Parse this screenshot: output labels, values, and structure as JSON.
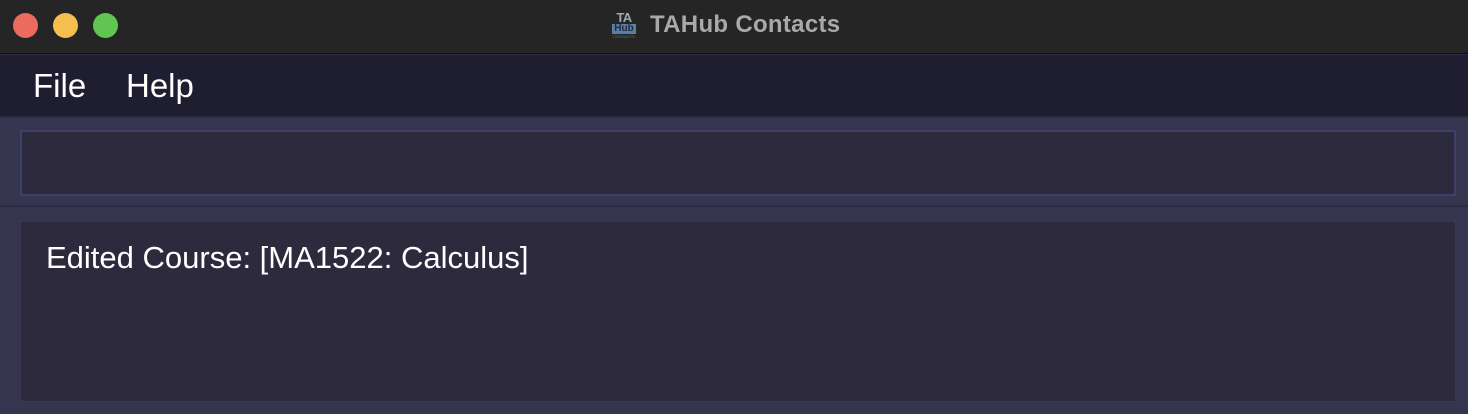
{
  "window": {
    "title": "TAHub Contacts",
    "app_icon": {
      "line1": "TA",
      "line2": "Hub",
      "line3": "CONTACTS"
    },
    "buttons": [
      "close",
      "minimize",
      "zoom"
    ]
  },
  "menubar": {
    "items": [
      {
        "label": "File"
      },
      {
        "label": "Help"
      }
    ]
  },
  "command": {
    "value": "",
    "placeholder": ""
  },
  "result": {
    "text": "Edited Course: [MA1522: Calculus]"
  },
  "colors": {
    "titlebar": "#252525",
    "menubar": "#1f1d30",
    "panel": "#363550",
    "box": "#2e2a3e",
    "close": "#ed6a5e",
    "minimize": "#f5bf4f",
    "zoom": "#61c554"
  }
}
